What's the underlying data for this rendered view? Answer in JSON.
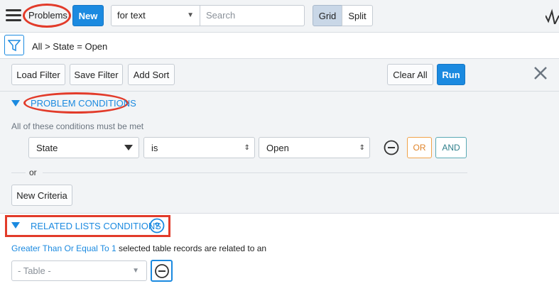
{
  "header": {
    "title": "Problems",
    "new_label": "New",
    "search_field": "for text",
    "search_placeholder": "Search",
    "view_grid": "Grid",
    "view_split": "Split"
  },
  "breadcrumb": {
    "root": "All",
    "separator": ">",
    "condition": "State = Open"
  },
  "filter_toolbar": {
    "load_filter": "Load Filter",
    "save_filter": "Save Filter",
    "add_sort": "Add Sort",
    "clear_all": "Clear All",
    "run": "Run"
  },
  "problem_conditions": {
    "title": "PROBLEM CONDITIONS",
    "subtitle": "All of these conditions must be met",
    "condition": {
      "field": "State",
      "operator": "is",
      "value": "Open"
    },
    "or_button": "OR",
    "and_button": "AND",
    "or_divider": "or",
    "new_criteria": "New Criteria"
  },
  "related_lists": {
    "title": "RELATED LISTS CONDITIONS",
    "quantifier_link": "Greater Than Or Equal To 1",
    "description": "selected table records are related to an",
    "table_placeholder": "- Table -"
  },
  "colors": {
    "accent": "#1b8ae0",
    "highlight": "#e23b2a",
    "or_orange": "#e0842a",
    "and_teal": "#2e7f8b"
  }
}
